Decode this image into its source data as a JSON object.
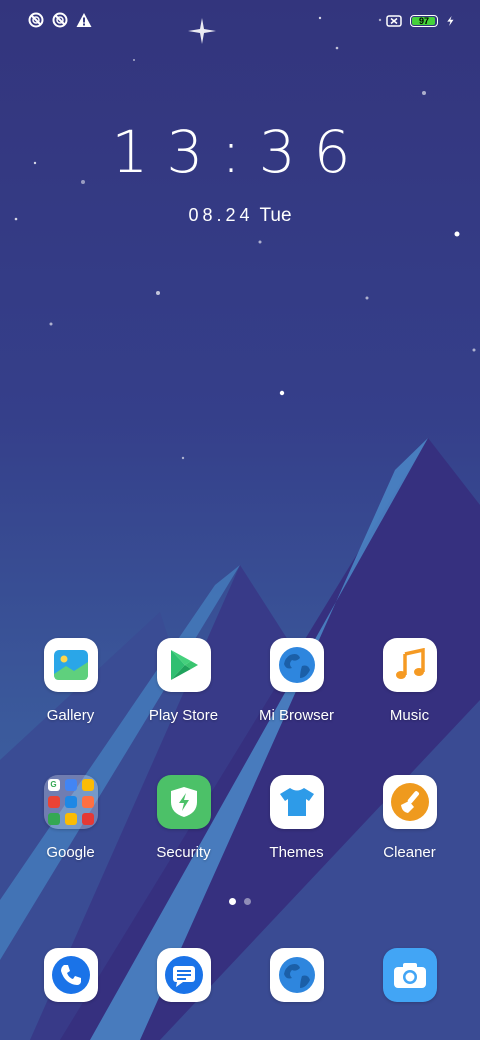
{
  "status_bar": {
    "left_icons": [
      "circle-slash-icon",
      "circle-slash-icon",
      "warning-icon"
    ],
    "battery_percent": "97",
    "battery_level": 0.97,
    "battery_color": "#45d13b"
  },
  "clock": {
    "time": "13:36",
    "date": "08.24",
    "day": "Tue"
  },
  "apps": [
    {
      "label": "Gallery",
      "icon": "gallery-icon"
    },
    {
      "label": "Play Store",
      "icon": "play-store-icon"
    },
    {
      "label": "Mi Browser",
      "icon": "browser-icon"
    },
    {
      "label": "Music",
      "icon": "music-icon"
    },
    {
      "label": "Google",
      "icon": "google-folder-icon"
    },
    {
      "label": "Security",
      "icon": "security-icon"
    },
    {
      "label": "Themes",
      "icon": "themes-icon"
    },
    {
      "label": "Cleaner",
      "icon": "cleaner-icon"
    }
  ],
  "page_indicator": {
    "pages": 2,
    "current": 1
  },
  "dock": [
    {
      "icon": "phone-icon"
    },
    {
      "icon": "messages-icon"
    },
    {
      "icon": "browser-icon"
    },
    {
      "icon": "camera-icon"
    }
  ],
  "colors": {
    "accent_blue": "#1a73e8",
    "music_orange": "#f59a23",
    "security_green": "#4cc168",
    "cleaner_orange": "#ef9a1e"
  }
}
